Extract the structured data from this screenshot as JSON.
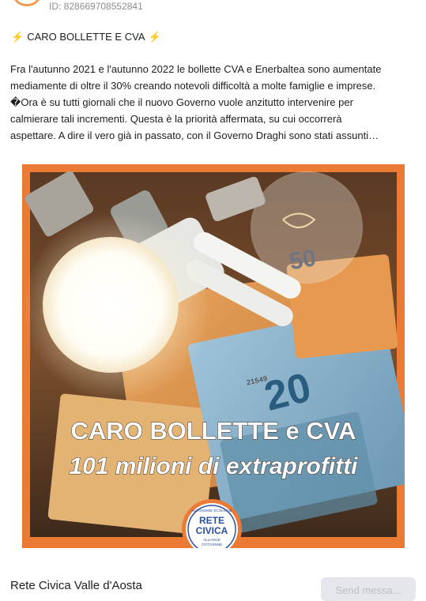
{
  "page_id": "ID: 828669708552841",
  "post": {
    "title": "CARO BOLLETTE E CVA",
    "body_lines": [
      "Fra l'autunno 2021 e l'autunno 2022 le bollette CVA e Enerbaltea sono aumentate",
      "mediamente di oltre il 30% creando notevoli difficoltà a molte famiglie e imprese.",
      "�Ora è su tutti giornali che il nuovo Governo vuole anzitutto intervenire per",
      "calmierare tali incrementi. Questa è la priorità affermata, su cui occorrerà",
      "aspettare. A dire il vero già in passato, con il Governo Draghi sono stati assunti…"
    ]
  },
  "media": {
    "headline": "CARO BOLLETTE e CVA",
    "subheadline": "101 milioni di extraprofitti",
    "logo": {
      "top_text": "AUTONOMIE ÉCOLOGIE",
      "line1": "RETE",
      "line2": "CIVICA",
      "bottom1": "ALLIANCE",
      "bottom2": "CITOYENNE"
    },
    "banknote_texts": [
      "50",
      "20",
      "21549"
    ],
    "colors": {
      "frame": "#ea7a34",
      "logo_blue": "#2b4fa0"
    }
  },
  "footer": {
    "page_name": "Rete Civica Valle d'Aosta",
    "send_button": "Send messa..."
  }
}
